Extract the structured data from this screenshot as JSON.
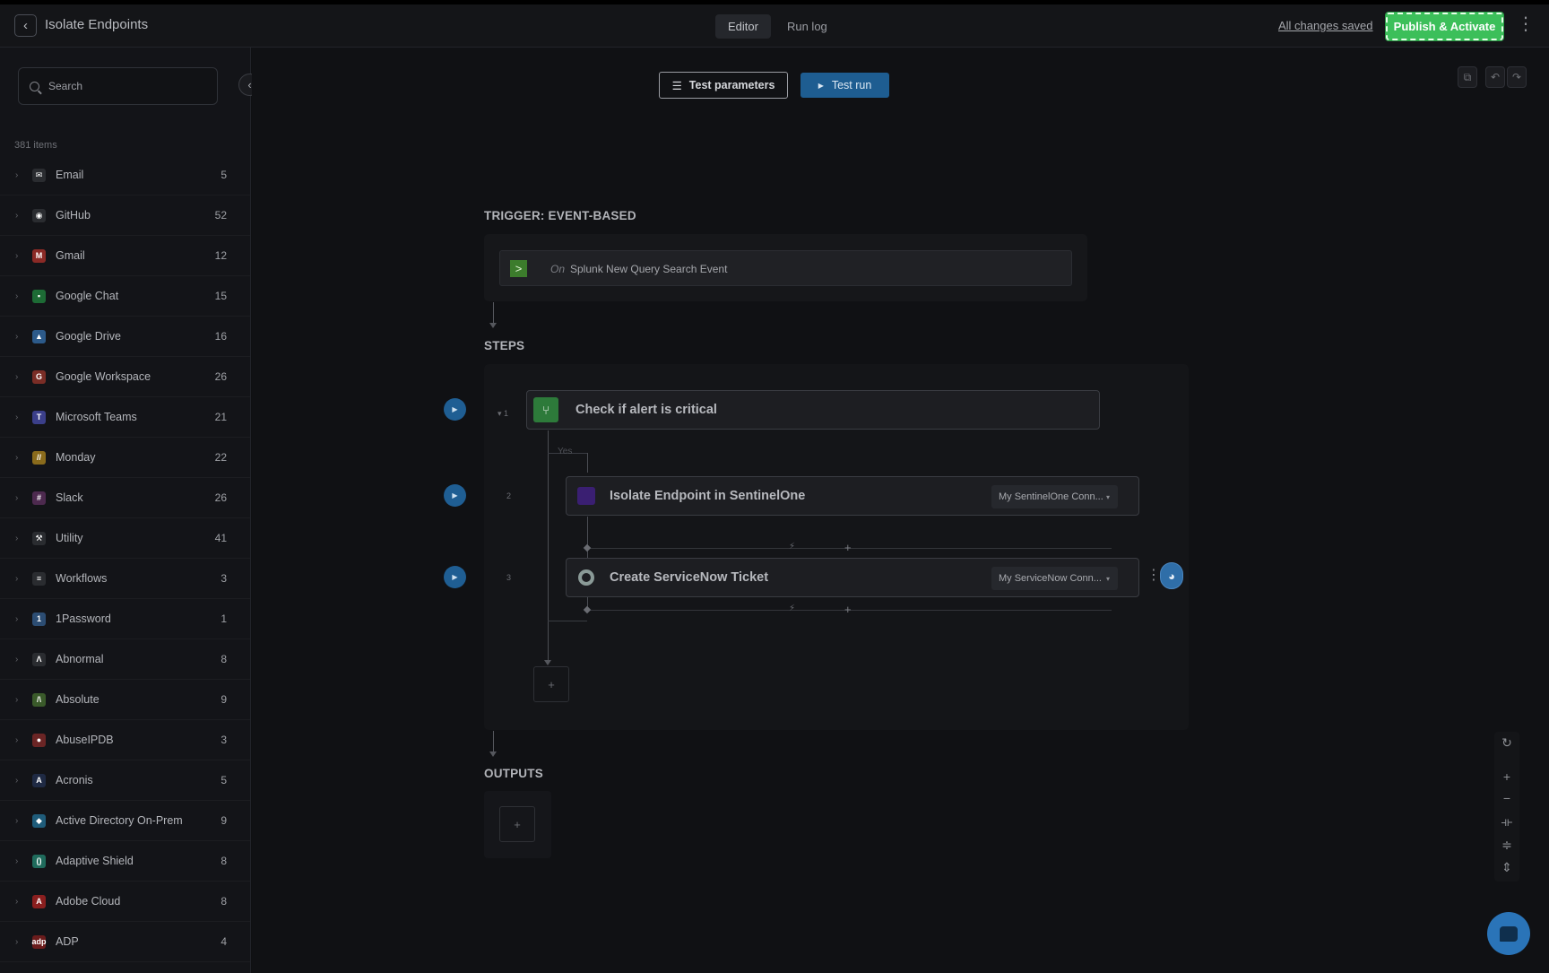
{
  "header": {
    "back_icon": "chevron-left-icon",
    "title": "Isolate Endpoints",
    "tabs": [
      {
        "label": "Editor",
        "active": true
      },
      {
        "label": "Run log",
        "active": false
      }
    ],
    "save_status": "All changes saved",
    "publish_label": "Publish & Activate",
    "accent_color": "#3cbf5a"
  },
  "sidebar": {
    "search_placeholder": "Search",
    "item_count": "381 items",
    "categories": [
      {
        "name": "Email",
        "count": "5",
        "icon": "email-icon",
        "color": "#2a2c30",
        "glyph": "✉"
      },
      {
        "name": "GitHub",
        "count": "52",
        "icon": "github-icon",
        "color": "#2a2c30",
        "glyph": "◉"
      },
      {
        "name": "Gmail",
        "count": "12",
        "icon": "gmail-icon",
        "color": "#8b2a26",
        "glyph": "M"
      },
      {
        "name": "Google Chat",
        "count": "15",
        "icon": "google-chat-icon",
        "color": "#1d6b35",
        "glyph": "▪"
      },
      {
        "name": "Google Drive",
        "count": "16",
        "icon": "google-drive-icon",
        "color": "#2c5a8a",
        "glyph": "▲"
      },
      {
        "name": "Google Workspace",
        "count": "26",
        "icon": "google-workspace-icon",
        "color": "#7a2d26",
        "glyph": "G"
      },
      {
        "name": "Microsoft Teams",
        "count": "21",
        "icon": "microsoft-teams-icon",
        "color": "#3b3f8a",
        "glyph": "T"
      },
      {
        "name": "Monday",
        "count": "22",
        "icon": "monday-icon",
        "color": "#8a6b1c",
        "glyph": "//"
      },
      {
        "name": "Slack",
        "count": "26",
        "icon": "slack-icon",
        "color": "#4d2a4f",
        "glyph": "#"
      },
      {
        "name": "Utility",
        "count": "41",
        "icon": "wrench-icon",
        "color": "#2a2c30",
        "glyph": "⚒"
      },
      {
        "name": "Workflows",
        "count": "3",
        "icon": "workflows-icon",
        "color": "#2a2c30",
        "glyph": "≡"
      },
      {
        "name": "1Password",
        "count": "1",
        "icon": "onepassword-icon",
        "color": "#2c4d73",
        "glyph": "1"
      },
      {
        "name": "Abnormal",
        "count": "8",
        "icon": "abnormal-icon",
        "color": "#2a2c30",
        "glyph": "Λ"
      },
      {
        "name": "Absolute",
        "count": "9",
        "icon": "absolute-icon",
        "color": "#3a5a2a",
        "glyph": "/\\"
      },
      {
        "name": "AbuseIPDB",
        "count": "3",
        "icon": "abuseipdb-icon",
        "color": "#6b2525",
        "glyph": "●"
      },
      {
        "name": "Acronis",
        "count": "5",
        "icon": "acronis-icon",
        "color": "#1f2a44",
        "glyph": "A"
      },
      {
        "name": "Active Directory On-Prem",
        "count": "9",
        "icon": "active-directory-icon",
        "color": "#1f5c7a",
        "glyph": "◆"
      },
      {
        "name": "Adaptive Shield",
        "count": "8",
        "icon": "adaptive-shield-icon",
        "color": "#1f6b5c",
        "glyph": "()"
      },
      {
        "name": "Adobe Cloud",
        "count": "8",
        "icon": "adobe-cloud-icon",
        "color": "#8a1f1f",
        "glyph": "A"
      },
      {
        "name": "ADP",
        "count": "4",
        "icon": "adp-icon",
        "color": "#6b1c1c",
        "glyph": "adp"
      }
    ]
  },
  "toolbar": {
    "test_params_label": "Test parameters",
    "test_run_label": "Test run"
  },
  "workflow": {
    "trigger_label": "TRIGGER: EVENT-BASED",
    "trigger_on": "On",
    "trigger_event": "Splunk New Query Search Event",
    "steps_label": "STEPS",
    "outputs_label": "OUTPUTS",
    "branch_label": "Yes",
    "steps": [
      {
        "num": "1",
        "title": "Check if alert is critical",
        "icon": "branch-icon"
      },
      {
        "num": "2",
        "title": "Isolate Endpoint in SentinelOne",
        "icon": "sentinelone-icon",
        "connection": "My SentinelOne Conn..."
      },
      {
        "num": "3",
        "title": "Create ServiceNow Ticket",
        "icon": "servicenow-icon",
        "connection": "My ServiceNow Conn..."
      }
    ]
  }
}
